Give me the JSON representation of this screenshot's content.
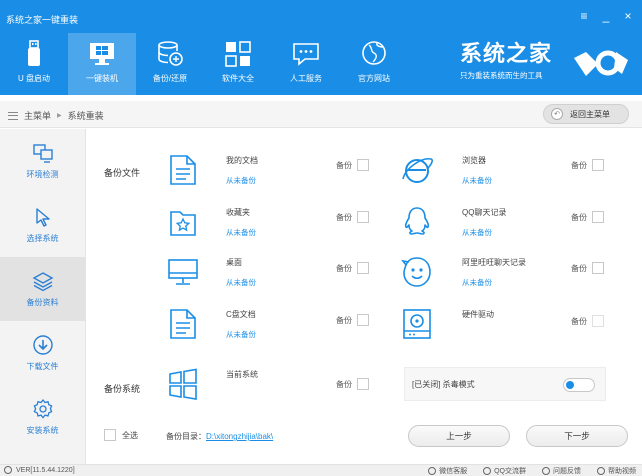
{
  "app": {
    "title": "系统之家一键重装",
    "win_menu": "≡",
    "win_min": "_",
    "win_close": "×"
  },
  "topnav": [
    {
      "label": "U 盘启动",
      "icon": "usb-drive-icon"
    },
    {
      "label": "一键装机",
      "icon": "monitor-windows-icon",
      "active": true
    },
    {
      "label": "备份/还原",
      "icon": "database-backup-icon"
    },
    {
      "label": "软件大全",
      "icon": "app-grid-icon"
    },
    {
      "label": "人工服务",
      "icon": "chat-bubble-icon"
    },
    {
      "label": "官方网站",
      "icon": "globe-icon"
    }
  ],
  "brand": {
    "name": "系统之家",
    "slogan": "只为重装系统而生的工具"
  },
  "breadcrumb": {
    "home": "主菜单",
    "separator": "▶",
    "current": "系统重装",
    "back_label": "返回主菜单"
  },
  "sidebar": [
    {
      "label": "环境检测",
      "icon": "environment-check-icon"
    },
    {
      "label": "选择系统",
      "icon": "cursor-select-icon"
    },
    {
      "label": "备份资料",
      "icon": "layers-backup-icon",
      "active": true
    },
    {
      "label": "下载文件",
      "icon": "download-icon"
    },
    {
      "label": "安装系统",
      "icon": "gear-install-icon"
    }
  ],
  "backup_files": {
    "section_title": "备份文件",
    "backup_label": "备份",
    "left": [
      {
        "name": "我的文档",
        "status": "从未备份",
        "icon": "document-icon"
      },
      {
        "name": "收藏夹",
        "status": "从未备份",
        "icon": "favorites-folder-icon"
      },
      {
        "name": "桌面",
        "status": "从未备份",
        "icon": "desktop-icon"
      },
      {
        "name": "C盘文档",
        "status": "从未备份",
        "icon": "document-icon"
      }
    ],
    "right": [
      {
        "name": "浏览器",
        "status": "从未备份",
        "icon": "ie-browser-icon"
      },
      {
        "name": "QQ聊天记录",
        "status": "从未备份",
        "icon": "qq-penguin-icon"
      },
      {
        "name": "阿里旺旺聊天记录",
        "status": "从未备份",
        "icon": "wangwang-icon"
      },
      {
        "name": "硬件驱动",
        "status": "",
        "icon": "hardware-driver-icon"
      }
    ]
  },
  "backup_system": {
    "section_title": "备份系统",
    "name": "当前系统",
    "backup_label": "备份",
    "icon": "windows-logo-icon"
  },
  "antivirus": {
    "label": "[已关闭] 杀毒模式"
  },
  "bottom": {
    "select_all": "全选",
    "dir_label": "备份目录：",
    "dir_path": "D:\\xitongzhijia\\bak\\",
    "prev": "上一步",
    "next": "下一步"
  },
  "statusbar": {
    "version": "VER[11.5.44.1220]",
    "links": [
      "微信客服",
      "QQ交流群",
      "问题反馈",
      "帮助视频"
    ]
  }
}
